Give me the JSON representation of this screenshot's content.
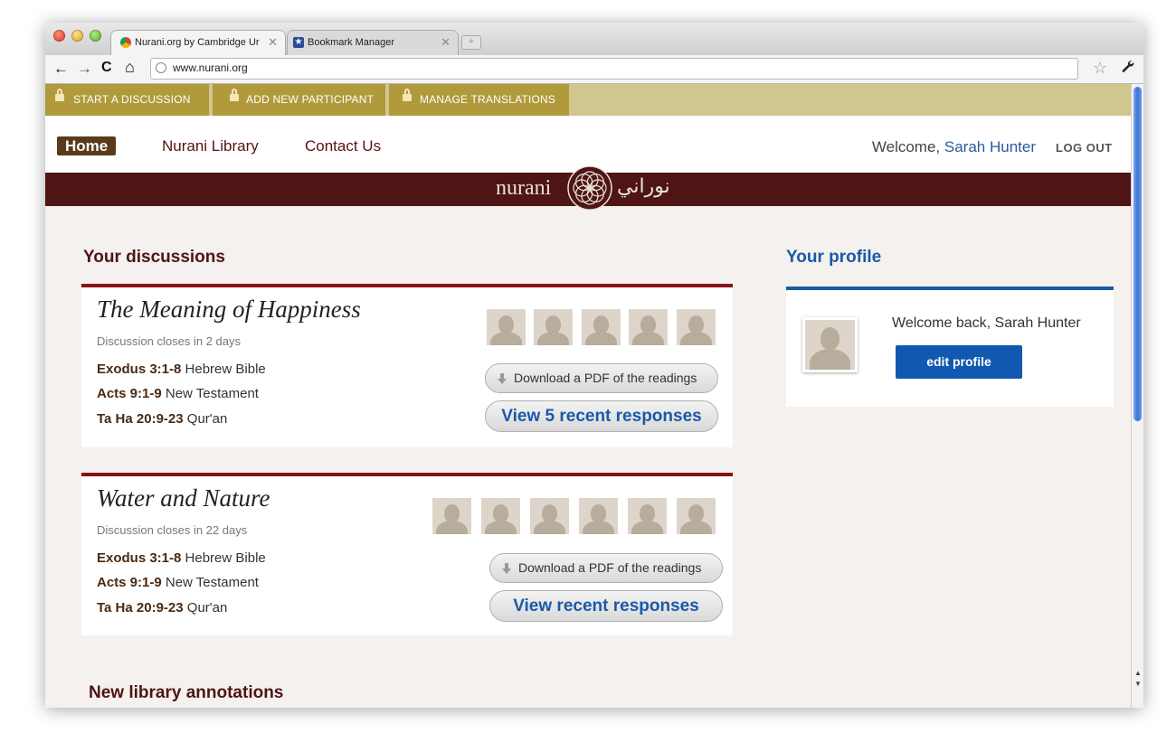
{
  "browser": {
    "tabs": [
      {
        "title": "Nurani.org  by Cambridge Ur",
        "active": true,
        "favicon": "chrome-favicon"
      },
      {
        "title": "Bookmark Manager",
        "active": false,
        "favicon": "star-favicon"
      }
    ],
    "url": "www.nurani.org",
    "nav_icons": {
      "back": "←",
      "forward": "→",
      "reload": "C",
      "home": "⌂"
    }
  },
  "admin_bar": {
    "items": [
      {
        "label": "START A DISCUSSION"
      },
      {
        "label": "ADD NEW PARTICIPANT"
      },
      {
        "label": "MANAGE TRANSLATIONS"
      }
    ]
  },
  "nav": {
    "home": "Home",
    "library": "Nurani Library",
    "contact": "Contact Us",
    "welcome_prefix": "Welcome, ",
    "user_name": "Sarah Hunter",
    "logout": "LOG OUT"
  },
  "brand": {
    "wordmark": "nurani",
    "arabic": "نوراني"
  },
  "discussions": {
    "heading": "Your discussions",
    "items": [
      {
        "title": "The Meaning of Happiness",
        "closes": "Discussion closes in 2 days",
        "readings": [
          {
            "ref": "Exodus 3:1-8",
            "source": " Hebrew Bible"
          },
          {
            "ref": "Acts 9:1-9",
            "source": " New Testament"
          },
          {
            "ref": "Ta Ha 20:9-23",
            "source": " Qur'an"
          }
        ],
        "participants": 5,
        "pdf_label": "Download a PDF of the readings",
        "responses_label": "View 5 recent responses"
      },
      {
        "title": "Water and Nature",
        "closes": "Discussion closes in 22 days",
        "readings": [
          {
            "ref": "Exodus 3:1-8",
            "source": " Hebrew Bible"
          },
          {
            "ref": "Acts 9:1-9",
            "source": " New Testament"
          },
          {
            "ref": "Ta Ha 20:9-23",
            "source": " Qur'an"
          }
        ],
        "participants": 6,
        "pdf_label": "Download a PDF of the readings",
        "responses_label": "View recent responses"
      }
    ]
  },
  "profile": {
    "heading": "Your profile",
    "welcome": "Welcome back, Sarah Hunter",
    "edit_label": "edit profile"
  },
  "annotations": {
    "heading": "New library annotations"
  },
  "colors": {
    "brand_maroon": "#4f1416",
    "admin_gold": "#b19a3c",
    "link_blue": "#1a5aa8",
    "card_border": "#8a1218"
  }
}
